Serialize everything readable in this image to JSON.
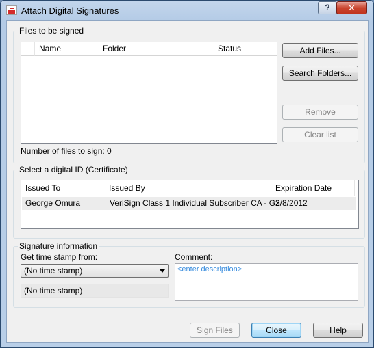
{
  "window": {
    "title": "Attach Digital Signatures",
    "help_button": "?",
    "close_button": "✕"
  },
  "files": {
    "group_label": "Files to be signed",
    "columns": [
      "Name",
      "Folder",
      "Status"
    ],
    "rows": [],
    "count_label": "Number of files to sign: 0",
    "buttons": {
      "add_files": "Add Files...",
      "search_folders": "Search Folders...",
      "remove": "Remove",
      "clear_list": "Clear list"
    }
  },
  "certificate": {
    "group_label": "Select a digital ID (Certificate)",
    "columns": [
      "Issued To",
      "Issued By",
      "Expiration Date"
    ],
    "rows": [
      {
        "issued_to": "George Omura",
        "issued_by": "VeriSign Class 1 Individual Subscriber CA - G3",
        "expiration": "2/8/2012"
      }
    ]
  },
  "signature": {
    "group_label": "Signature information",
    "timestamp_label": "Get time stamp from:",
    "timestamp_selected": "(No time stamp)",
    "timestamp_display": "(No time stamp)",
    "comment_label": "Comment:",
    "comment_placeholder": "<enter description>"
  },
  "footer": {
    "sign_files": "Sign Files",
    "close": "Close",
    "help": "Help"
  },
  "icons": {
    "app": "signature-document-icon",
    "dropdown": "chevron-down-icon"
  }
}
